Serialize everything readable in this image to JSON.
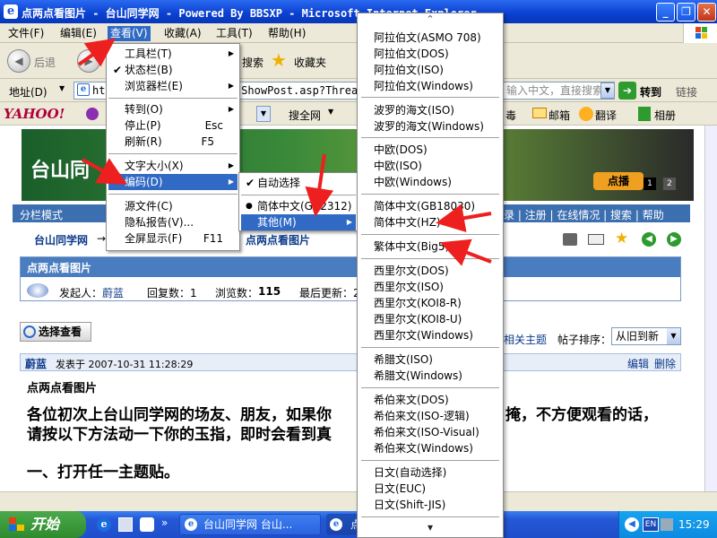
{
  "window": {
    "title": "点两点看图片 - 台山同学网 - Powered By BBSXP - Microsoft Internet Explorer",
    "min": "_",
    "max": "❐",
    "close": "✕"
  },
  "menubar": [
    "文件(F)",
    "编辑(E)",
    "查看(V)",
    "收藏(A)",
    "工具(T)",
    "帮助(H)"
  ],
  "toolbar": {
    "back": "后退",
    "search": "搜索",
    "favorites": "收藏夹"
  },
  "address": {
    "label": "地址(D)",
    "url": "http://www.tsclass.com/ShowPost.asp?ThreadID=1",
    "search_placeholder": "输入中文，直接搜索",
    "go": "转到",
    "links": "链接"
  },
  "yahoo": {
    "logo": "YAHOO!",
    "search_web": "搜全网",
    "mail_pre": "毒",
    "mail": "邮箱",
    "translate": "翻译",
    "album": "相册"
  },
  "view_menu": {
    "items": [
      {
        "label": "工具栏(T)",
        "arrow": true
      },
      {
        "label": "状态栏(B)",
        "check": "✔"
      },
      {
        "label": "浏览器栏(E)",
        "arrow": true
      },
      {
        "label": "转到(O)",
        "arrow": true
      },
      {
        "label": "停止(P)",
        "shortcut": "Esc"
      },
      {
        "label": "刷新(R)",
        "shortcut": "F5"
      },
      {
        "label": "文字大小(X)",
        "arrow": true
      },
      {
        "label": "编码(D)",
        "arrow": true
      },
      {
        "label": "源文件(C)"
      },
      {
        "label": "隐私报告(V)..."
      },
      {
        "label": "全屏显示(F)",
        "shortcut": "F11"
      }
    ]
  },
  "encoding_menu": {
    "items": [
      {
        "label": "自动选择",
        "mark": "✔"
      },
      {
        "label": "简体中文(GB2312)",
        "mark": "●"
      },
      {
        "label": "其他(M)"
      }
    ]
  },
  "other_menu": {
    "up": "⌃",
    "down": "▾",
    "items": [
      "阿拉伯文(ASMO 708)",
      "阿拉伯文(DOS)",
      "阿拉伯文(ISO)",
      "阿拉伯文(Windows)",
      "波罗的海文(ISO)",
      "波罗的海文(Windows)",
      "中欧(DOS)",
      "中欧(ISO)",
      "中欧(Windows)",
      "简体中文(GB18030)",
      "简体中文(HZ)",
      "繁体中文(Big5)",
      "西里尔文(DOS)",
      "西里尔文(ISO)",
      "西里尔文(KOI8-R)",
      "西里尔文(KOI8-U)",
      "西里尔文(Windows)",
      "希腊文(ISO)",
      "希腊文(Windows)",
      "希伯来文(DOS)",
      "希伯来文(ISO-逻辑)",
      "希伯来文(ISO-Visual)",
      "希伯来文(Windows)",
      "日文(自动选择)",
      "日文(EUC)",
      "日文(Shift-JIS)"
    ]
  },
  "page": {
    "banner_text": "台山同",
    "banner_button": "点播",
    "slide_1": "1",
    "slide_2": "2",
    "nav_left": "分栏模式",
    "nav_right": "录 | 注册 | 在线情况 | 搜索 | 帮助",
    "breadcrumb_site": "台山同学网",
    "breadcrumb_arrow": "→",
    "breadcrumb_thread": "点两点看图片",
    "thread_title": "点两点看图片",
    "info_author_label": "发起人：",
    "info_author": "蔚蓝",
    "info_replies": "回复数：1",
    "info_views_label": "浏览数：",
    "info_views": "115",
    "info_last": "最后更新：2",
    "choose_view": "选择查看",
    "related": "相关主题",
    "sort_label": "帖子排序：",
    "sort_value": "从旧到新",
    "post_author": "蔚蓝",
    "post_time": "发表于 2007-10-31 11:28:29",
    "edit": "编辑",
    "delete": "删除",
    "post_title": "点两点看图片",
    "body_line1_a": "各位初次上台山同学网的场友、朋友，如果你",
    "body_line1_b": "掩，不方便观看的话，",
    "body_line2": "请按以下方法动一下你的玉指，即时会看到真",
    "body_line3": "一、打开任一主题贴。"
  },
  "taskbar": {
    "start": "开始",
    "task1": "台山同学网 台山...",
    "task2": "点",
    "lang": "EN",
    "time": "15:29"
  }
}
